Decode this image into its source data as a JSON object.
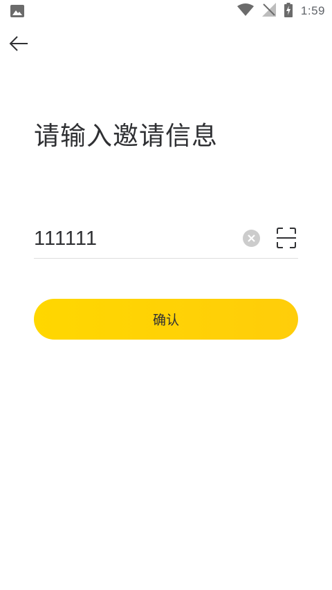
{
  "status_bar": {
    "time": "1:59",
    "left_icon": "image-icon",
    "wifi_icon": "wifi-icon",
    "signal_icon": "no-signal-icon",
    "battery_icon": "battery-charging-icon"
  },
  "header": {
    "back_icon": "arrow-left-icon"
  },
  "main": {
    "title": "请输入邀请信息",
    "invite_input": {
      "value": "111111",
      "placeholder": ""
    },
    "clear_icon": "close-circle-icon",
    "scan_icon": "scan-icon",
    "confirm_label": "确认"
  },
  "colors": {
    "accent": "#ffd000",
    "text": "#2f3033",
    "divider": "#dedede",
    "icon_gray": "#cccccc"
  }
}
